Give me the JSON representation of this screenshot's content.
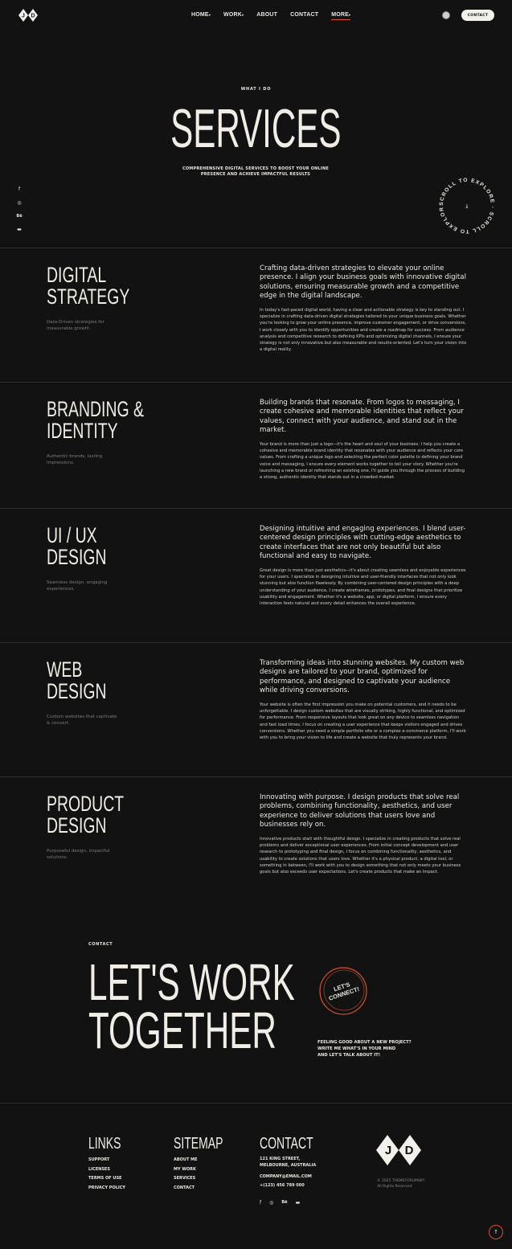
{
  "header": {
    "logo_text": "JD",
    "nav": [
      {
        "label": "HOME",
        "has_caret": true
      },
      {
        "label": "WORK",
        "has_caret": true
      },
      {
        "label": "ABOUT",
        "has_caret": false
      },
      {
        "label": "CONTACT",
        "has_caret": false
      },
      {
        "label": "MORE",
        "has_caret": true
      }
    ],
    "contact_button": "CONTACT"
  },
  "hero": {
    "eyebrow": "WHAT I DO",
    "title": "SERVICES",
    "subtitle": "COMPREHENSIVE DIGITAL SERVICES TO BOOST YOUR ONLINE PRESENCE AND ACHIEVE IMPACTFUL RESULTS",
    "scroll_badge": "SCROLL TO EXPLORE · SCROLL TO EXPLORE ·",
    "social_icons": [
      "facebook-icon",
      "dribbble-icon",
      "behance-icon",
      "youtube-icon"
    ]
  },
  "services": [
    {
      "title_lines": [
        "DIGITAL",
        "STRATEGY"
      ],
      "tag": "Data-Driven strategies for measurable growth.",
      "lead": "Crafting data-driven strategies to elevate your online presence. I align your business goals with innovative digital solutions, ensuring measurable growth and a competitive edge in the digital landscape.",
      "body": "In today's fast-paced digital world, having a clear and actionable strategy is key to standing out. I specialize in crafting data-driven digital strategies tailored to your unique business goals. Whether you're looking to grow your online presence, improve customer engagement, or drive conversions, I work closely with you to identify opportunities and create a roadmap for success. From audience analysis and competitive research to defining KPIs and optimizing digital channels, I ensure your strategy is not only innovative but also measurable and results-oriented. Let's turn your vision into a digital reality."
    },
    {
      "title_lines": [
        "BRANDING &",
        "IDENTITY"
      ],
      "tag": "Authentic brands, lasting impressions.",
      "lead": "Building brands that resonate. From logos to messaging, I create cohesive and memorable identities that reflect your values, connect with your audience, and stand out in the market.",
      "body": "Your brand is more than just a logo—it's the heart and soul of your business. I help you create a cohesive and memorable brand identity that resonates with your audience and reflects your core values. From crafting a unique logo and selecting the perfect color palette to defining your brand voice and messaging, I ensure every element works together to tell your story. Whether you're launching a new brand or refreshing an existing one, I'll guide you through the process of building a strong, authentic identity that stands out in a crowded market."
    },
    {
      "title_lines": [
        "UI / UX",
        "DESIGN"
      ],
      "tag": "Seamless design, engaging experiences.",
      "lead": "Designing intuitive and engaging experiences. I blend user-centered design principles with cutting-edge aesthetics to create interfaces that are not only beautiful but also functional and easy to navigate.",
      "body": "Great design is more than just aesthetics—it's about creating seamless and enjoyable experiences for your users. I specialize in designing intuitive and user-friendly interfaces that not only look stunning but also function flawlessly. By combining user-centered design principles with a deep understanding of your audience, I create wireframes, prototypes, and final designs that prioritize usability and engagement. Whether it's a website, app, or digital platform, I ensure every interaction feels natural and every detail enhances the overall experience."
    },
    {
      "title_lines": [
        "WEB",
        "DESIGN"
      ],
      "tag": "Custom websites that captivate & convert.",
      "lead": "Transforming ideas into stunning websites. My custom web designs are tailored to your brand, optimized for performance, and designed to captivate your audience while driving conversions.",
      "body": "Your website is often the first impression you make on potential customers, and it needs to be unforgettable. I design custom websites that are visually striking, highly functional, and optimized for performance. From responsive layouts that look great on any device to seamless navigation and fast load times, I focus on creating a user experience that keeps visitors engaged and drives conversions. Whether you need a simple portfolio site or a complex e-commerce platform, I'll work with you to bring your vision to life and create a website that truly represents your brand."
    },
    {
      "title_lines": [
        "PRODUCT",
        "DESIGN"
      ],
      "tag": "Purposeful design, impactful solutions.",
      "lead": "Innovating with purpose. I design products that solve real problems, combining functionality, aesthetics, and user experience to deliver solutions that users love and businesses rely on.",
      "body": "Innovative products start with thoughtful design. I specialize in creating products that solve real problems and deliver exceptional user experiences. From initial concept development and user research to prototyping and final design, I focus on combining functionality, aesthetics, and usability to create solutions that users love. Whether it's a physical product, a digital tool, or something in between, I'll work with you to design something that not only meets your business goals but also exceeds user expectations. Let's create products that make an impact."
    }
  ],
  "contact": {
    "eyebrow": "CONTACT",
    "headline_lines": [
      "LET'S WORK",
      "TOGETHER"
    ],
    "badge_lines": [
      "LET'S",
      "CONNECT!"
    ],
    "text_lines": [
      "FEELING GOOD ABOUT A NEW PROJECT?",
      "WRITE ME WHAT'S IN YOUR MIND",
      "AND LET'S TALK ABOUT IT!"
    ]
  },
  "footer": {
    "links_heading": "LINKS",
    "links": [
      "SUPPORT",
      "LICENSES",
      "TERMS OF USE",
      "PRIVACY POLICY"
    ],
    "sitemap_heading": "SITEMAP",
    "sitemap": [
      "ABOUT ME",
      "MY WORK",
      "SERVICES",
      "CONTACT"
    ],
    "contact_heading": "CONTACT",
    "address_lines": [
      "121 KING STREET,",
      "MELBOURNE, AUSTRALIA"
    ],
    "email": "COMPANY@EMAIL.COM",
    "phone": "+(123) 456 789 000",
    "logo_text": "JD",
    "copyright": "© 2025 THEMEFORUMSKY",
    "rights": "All Rights Reserved"
  },
  "colors": {
    "background": "#121212",
    "accent": "#d6532b",
    "text": "#e9e6df"
  }
}
